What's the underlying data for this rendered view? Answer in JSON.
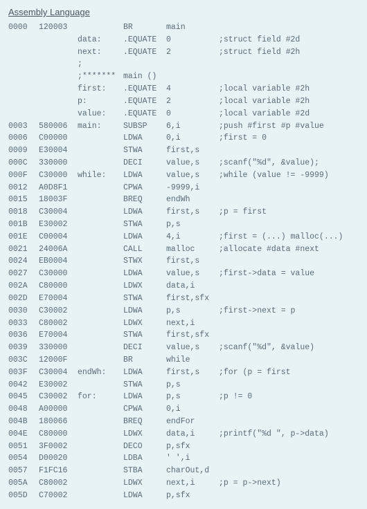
{
  "title": "Assembly Language",
  "columns": [
    "addr",
    "obj",
    "label",
    "op",
    "oper",
    "cmt"
  ],
  "rows": [
    {
      "addr": "0000",
      "obj": "120003",
      "label": "",
      "op": "BR",
      "oper": "main",
      "cmt": ""
    },
    {
      "addr": "",
      "obj": "",
      "label": "data:",
      "op": ".EQUATE",
      "oper": "0",
      "cmt": ";struct field #2d"
    },
    {
      "addr": "",
      "obj": "",
      "label": "next:",
      "op": ".EQUATE",
      "oper": "2",
      "cmt": ";struct field #2h"
    },
    {
      "addr": "",
      "obj": "",
      "label": ";",
      "op": "",
      "oper": "",
      "cmt": ""
    },
    {
      "addr": "",
      "obj": "",
      "label": ";*******",
      "op": "main ()",
      "oper": "",
      "cmt": ""
    },
    {
      "addr": "",
      "obj": "",
      "label": "first:",
      "op": ".EQUATE",
      "oper": "4",
      "cmt": ";local variable #2h"
    },
    {
      "addr": "",
      "obj": "",
      "label": "p:",
      "op": ".EQUATE",
      "oper": "2",
      "cmt": ";local variable #2h"
    },
    {
      "addr": "",
      "obj": "",
      "label": "value:",
      "op": ".EQUATE",
      "oper": "0",
      "cmt": ";local variable #2d"
    },
    {
      "addr": "0003",
      "obj": "580006",
      "label": "main:",
      "op": "SUBSP",
      "oper": "6,i",
      "cmt": ";push #first #p #value"
    },
    {
      "addr": "0006",
      "obj": "C00000",
      "label": "",
      "op": "LDWA",
      "oper": "0,i",
      "cmt": ";first = 0"
    },
    {
      "addr": "0009",
      "obj": "E30004",
      "label": "",
      "op": "STWA",
      "oper": "first,s",
      "cmt": ""
    },
    {
      "addr": "000C",
      "obj": "330000",
      "label": "",
      "op": "DECI",
      "oper": "value,s",
      "cmt": ";scanf(\"%d\", &value);"
    },
    {
      "addr": "000F",
      "obj": "C30000",
      "label": "while:",
      "op": "LDWA",
      "oper": "value,s",
      "cmt": ";while (value != -9999)"
    },
    {
      "addr": "0012",
      "obj": "A0D8F1",
      "label": "",
      "op": "CPWA",
      "oper": "-9999,i",
      "cmt": ""
    },
    {
      "addr": "0015",
      "obj": "18003F",
      "label": "",
      "op": "BREQ",
      "oper": "endWh",
      "cmt": ""
    },
    {
      "addr": "0018",
      "obj": "C30004",
      "label": "",
      "op": "LDWA",
      "oper": "first,s",
      "cmt": ";p = first"
    },
    {
      "addr": "001B",
      "obj": "E30002",
      "label": "",
      "op": "STWA",
      "oper": "p,s",
      "cmt": ""
    },
    {
      "addr": "001E",
      "obj": "C00004",
      "label": "",
      "op": "LDWA",
      "oper": "4,i",
      "cmt": ";first = (...) malloc(...)"
    },
    {
      "addr": "0021",
      "obj": "24006A",
      "label": "",
      "op": "CALL",
      "oper": "malloc",
      "cmt": ";allocate #data #next"
    },
    {
      "addr": "0024",
      "obj": "EB0004",
      "label": "",
      "op": "STWX",
      "oper": "first,s",
      "cmt": ""
    },
    {
      "addr": "0027",
      "obj": "C30000",
      "label": "",
      "op": "LDWA",
      "oper": "value,s",
      "cmt": ";first->data = value"
    },
    {
      "addr": "002A",
      "obj": "C80000",
      "label": "",
      "op": "LDWX",
      "oper": "data,i",
      "cmt": ""
    },
    {
      "addr": "002D",
      "obj": "E70004",
      "label": "",
      "op": "STWA",
      "oper": "first,sfx",
      "cmt": ""
    },
    {
      "addr": "0030",
      "obj": "C30002",
      "label": "",
      "op": "LDWA",
      "oper": "p,s",
      "cmt": ";first->next = p"
    },
    {
      "addr": "0033",
      "obj": "C80002",
      "label": "",
      "op": "LDWX",
      "oper": "next,i",
      "cmt": ""
    },
    {
      "addr": "0036",
      "obj": "E70004",
      "label": "",
      "op": "STWA",
      "oper": "first,sfx",
      "cmt": ""
    },
    {
      "addr": "0039",
      "obj": "330000",
      "label": "",
      "op": "DECI",
      "oper": "value,s",
      "cmt": ";scanf(\"%d\", &value)"
    },
    {
      "addr": "003C",
      "obj": "12000F",
      "label": "",
      "op": "BR",
      "oper": "while",
      "cmt": ""
    },
    {
      "addr": "003F",
      "obj": "C30004",
      "label": "endWh:",
      "op": "LDWA",
      "oper": "first,s",
      "cmt": ";for (p = first"
    },
    {
      "addr": "0042",
      "obj": "E30002",
      "label": "",
      "op": "STWA",
      "oper": "p,s",
      "cmt": ""
    },
    {
      "addr": "0045",
      "obj": "C30002",
      "label": "for:",
      "op": "LDWA",
      "oper": "p,s",
      "cmt": ";p != 0"
    },
    {
      "addr": "0048",
      "obj": "A00000",
      "label": "",
      "op": "CPWA",
      "oper": "0,i",
      "cmt": ""
    },
    {
      "addr": "004B",
      "obj": "180066",
      "label": "",
      "op": "BREQ",
      "oper": "endFor",
      "cmt": ""
    },
    {
      "addr": "004E",
      "obj": "C80000",
      "label": "",
      "op": "LDWX",
      "oper": "data,i",
      "cmt": ";printf(\"%d \", p->data)"
    },
    {
      "addr": "0051",
      "obj": "3F0002",
      "label": "",
      "op": "DECO",
      "oper": "p,sfx",
      "cmt": ""
    },
    {
      "addr": "0054",
      "obj": "D00020",
      "label": "",
      "op": "LDBA",
      "oper": "' ',i",
      "cmt": ""
    },
    {
      "addr": "0057",
      "obj": "F1FC16",
      "label": "",
      "op": "STBA",
      "oper": "charOut,d",
      "cmt": ""
    },
    {
      "addr": "005A",
      "obj": "C80002",
      "label": "",
      "op": "LDWX",
      "oper": "next,i",
      "cmt": ";p = p->next)"
    },
    {
      "addr": "005D",
      "obj": "C70002",
      "label": "",
      "op": "LDWA",
      "oper": "p,sfx",
      "cmt": ""
    }
  ]
}
